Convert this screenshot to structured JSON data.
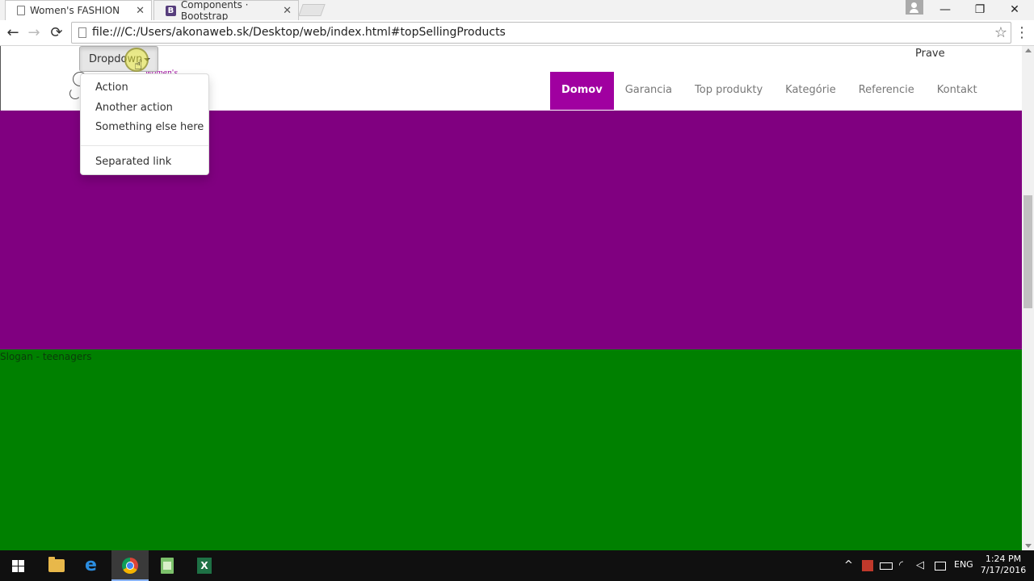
{
  "browser": {
    "tabs": [
      {
        "title": "Women's FASHION",
        "active": true
      },
      {
        "title": "Components · Bootstrap",
        "active": false
      }
    ],
    "url": "file:///C:/Users/akonaweb.sk/Desktop/web/index.html#topSellingProducts",
    "window_controls": {
      "minimize": "—",
      "restore": "❐",
      "close": "✕"
    },
    "nav": {
      "back": "←",
      "forward": "→",
      "reload": "⟳"
    },
    "bookmark_icon": "star-icon"
  },
  "page": {
    "dropdown": {
      "toggle_label": "Dropdown",
      "items": [
        "Action",
        "Another action",
        "Something else here"
      ],
      "separated_item": "Separated link"
    },
    "logo_text": "women's",
    "top_right_text": "Prave",
    "nav_items": [
      {
        "label": "Domov",
        "active": true
      },
      {
        "label": "Garancia",
        "active": false
      },
      {
        "label": "Top produkty",
        "active": false
      },
      {
        "label": "Kategórie",
        "active": false
      },
      {
        "label": "Referencie",
        "active": false
      },
      {
        "label": "Kontakt",
        "active": false
      }
    ],
    "slogan": "Slogan - teenagers",
    "colors": {
      "nav_active": "#a000a0",
      "purple_band": "#800080",
      "green_band": "#008000"
    }
  },
  "taskbar": {
    "apps": [
      "file-explorer-icon",
      "edge-icon",
      "chrome-icon",
      "notepad-icon",
      "excel-icon"
    ],
    "tray": {
      "language": "ENG",
      "time": "1:24 PM",
      "date": "7/17/2016"
    }
  }
}
